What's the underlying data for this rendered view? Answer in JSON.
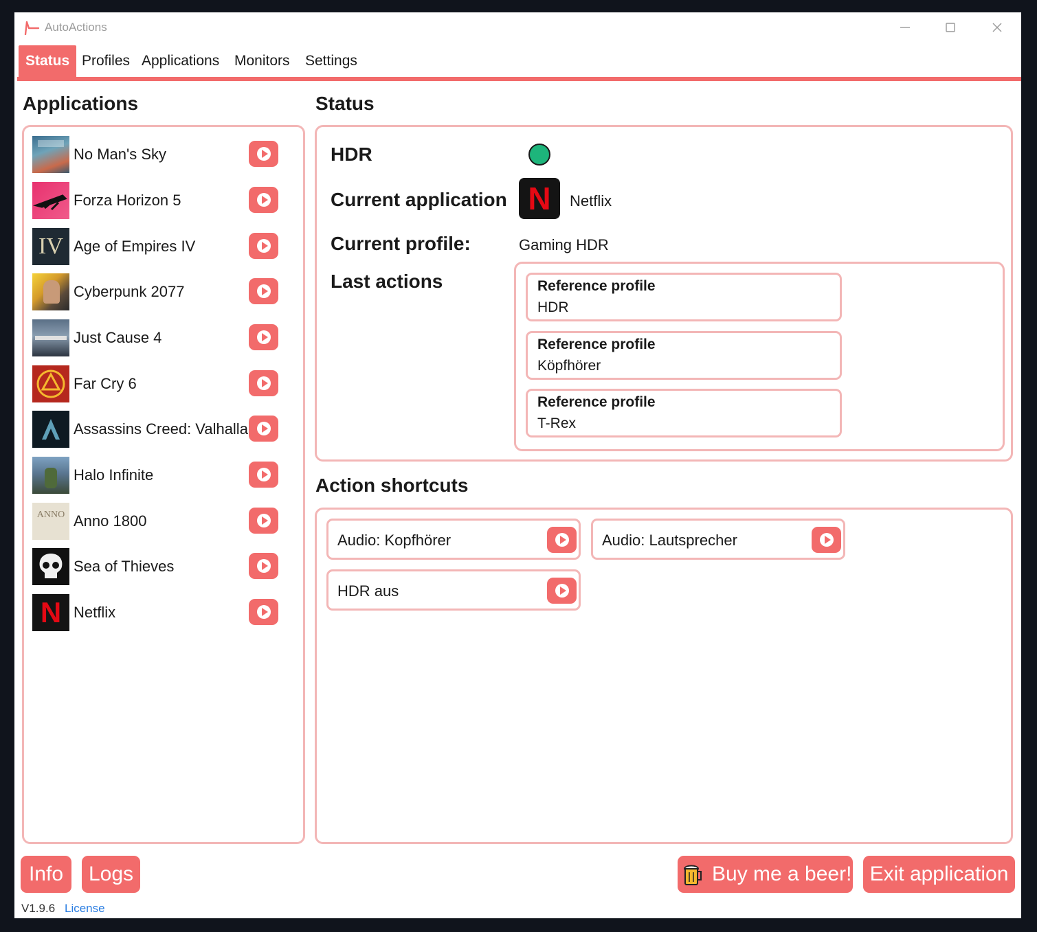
{
  "window": {
    "title": "AutoActions",
    "accent_color": "#f26b6b",
    "border_color": "#f3b6b6"
  },
  "tabs": [
    {
      "label": "Status",
      "active": true
    },
    {
      "label": "Profiles"
    },
    {
      "label": "Applications"
    },
    {
      "label": "Monitors"
    },
    {
      "label": "Settings"
    }
  ],
  "applications": {
    "heading": "Applications",
    "items": [
      {
        "name": "No Man's Sky",
        "icon": "no-mans-sky-icon"
      },
      {
        "name": "Forza Horizon 5",
        "icon": "forza-horizon-5-icon"
      },
      {
        "name": "Age of Empires IV",
        "icon": "age-of-empires-iv-icon",
        "icon_text": "IV"
      },
      {
        "name": "Cyberpunk 2077",
        "icon": "cyberpunk-2077-icon"
      },
      {
        "name": "Just Cause 4",
        "icon": "just-cause-4-icon"
      },
      {
        "name": "Far Cry 6",
        "icon": "far-cry-6-icon"
      },
      {
        "name": "Assassins Creed: Valhalla",
        "icon": "assassins-creed-valhalla-icon"
      },
      {
        "name": "Halo Infinite",
        "icon": "halo-infinite-icon"
      },
      {
        "name": "Anno 1800",
        "icon": "anno-1800-icon",
        "icon_text": "ANNO"
      },
      {
        "name": "Sea of Thieves",
        "icon": "sea-of-thieves-icon"
      },
      {
        "name": "Netflix",
        "icon": "netflix-icon",
        "icon_text": "N"
      }
    ]
  },
  "status": {
    "heading": "Status",
    "hdr_label": "HDR",
    "hdr_state_color": "#1db57b",
    "current_application_label": "Current application",
    "current_application_value": "Netflix",
    "current_application_icon_text": "N",
    "current_profile_label": "Current profile:",
    "current_profile_value": "Gaming HDR",
    "last_actions_label": "Last actions",
    "last_actions": [
      {
        "title": "Reference profile",
        "value": "HDR"
      },
      {
        "title": "Reference profile",
        "value": "Köpfhörer"
      },
      {
        "title": "Reference profile",
        "value": "T-Rex"
      }
    ]
  },
  "shortcuts": {
    "heading": "Action shortcuts",
    "items": [
      {
        "label": "Audio: Kopfhörer"
      },
      {
        "label": "Audio: Lautsprecher"
      },
      {
        "label": "HDR aus"
      }
    ]
  },
  "footer": {
    "info_label": "Info",
    "logs_label": "Logs",
    "beer_label": "Buy me a beer!",
    "exit_label": "Exit application",
    "version": "V1.9.6",
    "license_label": "License"
  }
}
